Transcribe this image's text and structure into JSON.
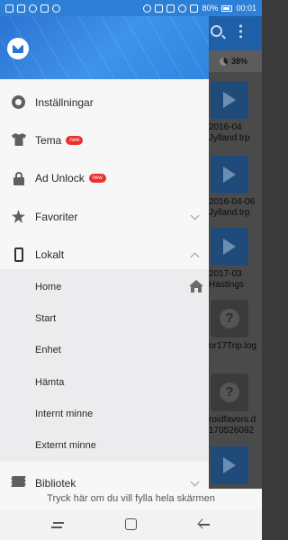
{
  "status_bar": {
    "battery": "80%",
    "time": "00:01"
  },
  "drawer": {
    "items": [
      {
        "label": "Inställningar",
        "icon": "gear-icon"
      },
      {
        "label": "Tema",
        "icon": "shirt-icon",
        "badge": "new"
      },
      {
        "label": "Ad Unlock",
        "icon": "lock-icon",
        "badge": "new"
      },
      {
        "label": "Favoriter",
        "icon": "star-icon",
        "expanded": false
      },
      {
        "label": "Lokalt",
        "icon": "phone-icon",
        "expanded": true
      },
      {
        "label": "Bibliotek",
        "icon": "library-icon",
        "expanded": false
      }
    ],
    "local_sub_items": [
      {
        "label": "Home"
      },
      {
        "label": "Start"
      },
      {
        "label": "Enhet"
      },
      {
        "label": "Hämta"
      },
      {
        "label": "Internt minne"
      },
      {
        "label": "Externt minne"
      }
    ]
  },
  "background_app": {
    "storage_percent": "38%",
    "files": [
      {
        "line1": "2016-04",
        "line2": "Jylland.trp",
        "type": "video"
      },
      {
        "line1": "2016-04-06",
        "line2": "Jylland.trp",
        "type": "video"
      },
      {
        "line1": "2017-03",
        "line2": "Hastings",
        "type": "video"
      },
      {
        "line1": "or17Trip.log",
        "line2": "",
        "type": "unknown"
      },
      {
        "line1": "roidfavors.d",
        "line2": "170526092",
        "type": "unknown"
      }
    ]
  },
  "fullscreen_hint": "Tryck här om du vill fylla hela skärmen",
  "colors": {
    "accent": "#2e7fd6",
    "badge": "#e8322f"
  }
}
